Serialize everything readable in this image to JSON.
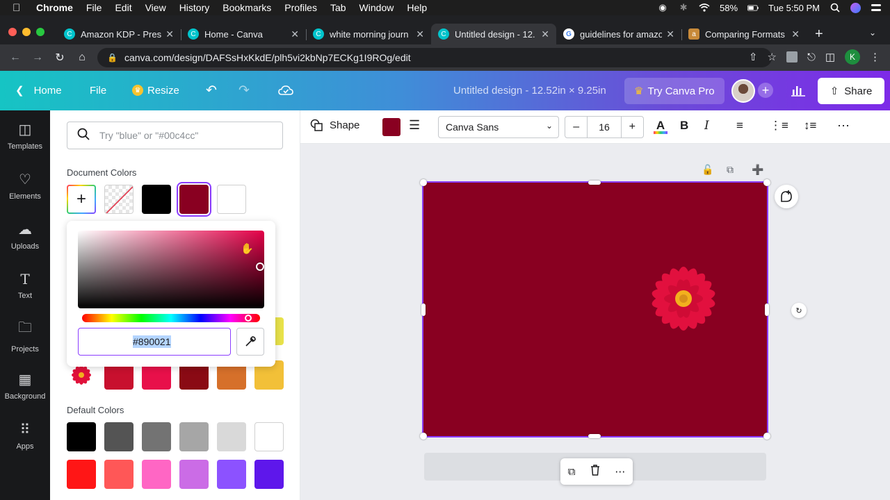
{
  "mac_menu": {
    "app": "Chrome",
    "items": [
      "File",
      "Edit",
      "View",
      "History",
      "Bookmarks",
      "Profiles",
      "Tab",
      "Window",
      "Help"
    ],
    "battery": "58%",
    "clock": "Tue 5:50 PM"
  },
  "browser": {
    "tabs": [
      {
        "title": "Amazon KDP - Prese",
        "icon": "canva"
      },
      {
        "title": "Home - Canva",
        "icon": "canva"
      },
      {
        "title": "white morning journ",
        "icon": "canva"
      },
      {
        "title": "Untitled design - 12.",
        "icon": "canva",
        "active": true
      },
      {
        "title": "guidelines for amazo",
        "icon": "google"
      },
      {
        "title": "Comparing Formats",
        "icon": "kdp"
      }
    ],
    "url": "canva.com/design/DAFSsHxKkdE/plh5vi2kbNp7ECKg1I9ROg/edit",
    "profile_initial": "K"
  },
  "canva_header": {
    "home": "Home",
    "file": "File",
    "resize": "Resize",
    "title": "Untitled design - 12.52in × 9.25in",
    "try_pro": "Try Canva Pro",
    "share": "Share"
  },
  "rail": [
    {
      "label": "Templates",
      "icon": "templates-icon"
    },
    {
      "label": "Elements",
      "icon": "elements-icon"
    },
    {
      "label": "Uploads",
      "icon": "uploads-icon"
    },
    {
      "label": "Text",
      "icon": "text-icon"
    },
    {
      "label": "Projects",
      "icon": "projects-icon"
    },
    {
      "label": "Background",
      "icon": "background-icon"
    },
    {
      "label": "Apps",
      "icon": "apps-icon"
    }
  ],
  "panel": {
    "search_placeholder": "Try \"blue\" or \"#00c4cc\"",
    "document_colors_title": "Document Colors",
    "document_colors": [
      "#000000",
      "#890021",
      "#ffffff"
    ],
    "photo_colors": [
      "#c8102e",
      "#e8104a",
      "#8a0a14",
      "#d6702a",
      "#f2c038"
    ],
    "default_colors_title": "Default Colors",
    "default_colors_row1": [
      "#000000",
      "#545454",
      "#737373",
      "#a6a6a6",
      "#d9d9d9",
      "#ffffff"
    ],
    "default_colors_row2": [
      "#ff1616",
      "#ff5757",
      "#ff66c4",
      "#cb6ce6",
      "#8c52ff",
      "#5e17eb"
    ]
  },
  "picker": {
    "hex": "#890021"
  },
  "toolbar": {
    "shape": "Shape",
    "font": "Canva Sans",
    "size": "16",
    "color": "#890021"
  },
  "design": {
    "page_color": "#890021"
  }
}
